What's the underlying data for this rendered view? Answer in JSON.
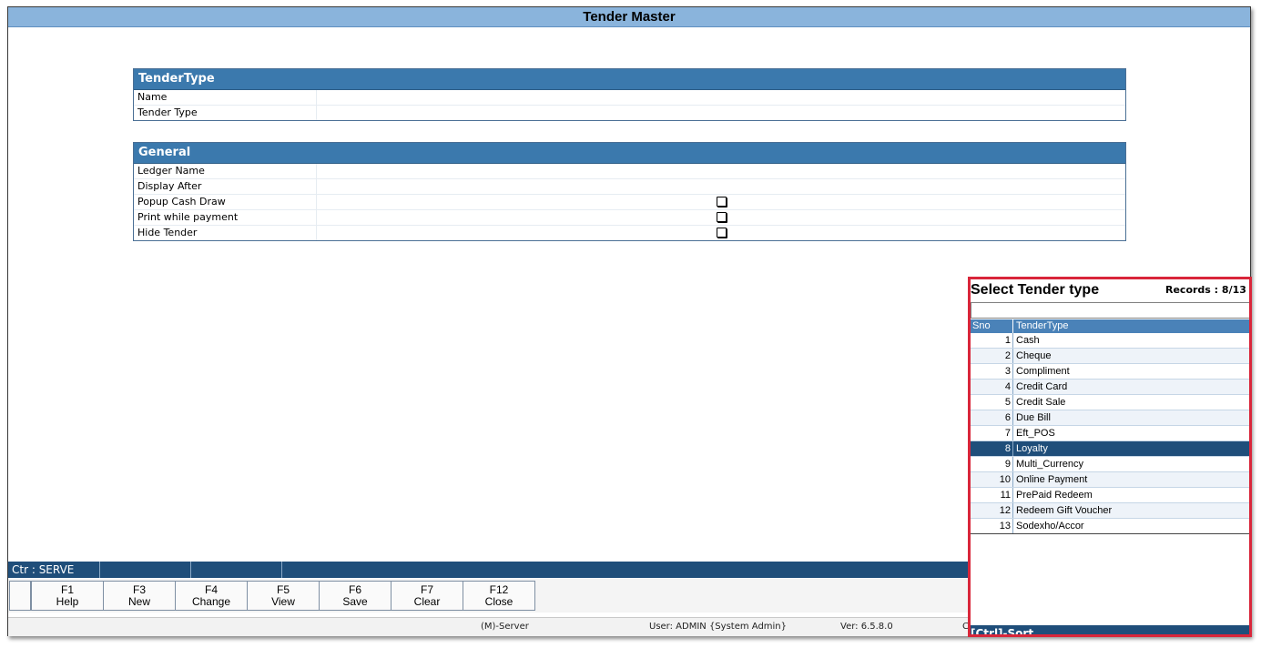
{
  "window": {
    "title": "Tender Master"
  },
  "tender_type_section": {
    "heading": "TenderType",
    "fields": [
      {
        "label": "Name",
        "value": ""
      },
      {
        "label": "Tender Type",
        "value": ""
      }
    ]
  },
  "general_section": {
    "heading": "General",
    "fields": [
      {
        "label": "Ledger Name",
        "value": ""
      },
      {
        "label": "Display After",
        "value": ""
      },
      {
        "label": "Popup Cash Draw",
        "checked": false
      },
      {
        "label": "Print while payment",
        "checked": false
      },
      {
        "label": "Hide Tender",
        "checked": false
      }
    ]
  },
  "status_bar": {
    "counter": "Ctr : SERVE"
  },
  "function_keys": [
    {
      "key": "F1",
      "label": "Help"
    },
    {
      "key": "F3",
      "label": "New"
    },
    {
      "key": "F4",
      "label": "Change"
    },
    {
      "key": "F5",
      "label": "View"
    },
    {
      "key": "F6",
      "label": "Save"
    },
    {
      "key": "F7",
      "label": "Clear"
    },
    {
      "key": "F12",
      "label": "Close"
    }
  ],
  "footer": {
    "server": "(M)-Server",
    "user": "User: ADMIN {System Admin}",
    "version": "Ver: 6.5.8.0",
    "extra": "C"
  },
  "popup": {
    "title": "Select Tender type",
    "records": "Records : 8/13",
    "search_value": "",
    "columns": {
      "sno": "Sno",
      "tender_type": "TenderType"
    },
    "selected_sno": 8,
    "rows": [
      {
        "sno": "1",
        "tender_type": "Cash"
      },
      {
        "sno": "2",
        "tender_type": "Cheque"
      },
      {
        "sno": "3",
        "tender_type": "Compliment"
      },
      {
        "sno": "4",
        "tender_type": "Credit Card"
      },
      {
        "sno": "5",
        "tender_type": "Credit Sale"
      },
      {
        "sno": "6",
        "tender_type": "Due Bill"
      },
      {
        "sno": "7",
        "tender_type": "Eft_POS"
      },
      {
        "sno": "8",
        "tender_type": "Loyalty"
      },
      {
        "sno": "9",
        "tender_type": "Multi_Currency"
      },
      {
        "sno": "10",
        "tender_type": "Online Payment"
      },
      {
        "sno": "11",
        "tender_type": "PrePaid Redeem"
      },
      {
        "sno": "12",
        "tender_type": "Redeem Gift Voucher"
      },
      {
        "sno": "13",
        "tender_type": "Sodexho/Accor"
      }
    ],
    "footer_hint": "[Ctrl]-Sort"
  },
  "colors": {
    "title_bar": "#8ab4dc",
    "section_header": "#3b79ad",
    "status_bar": "#1f4e7a",
    "selected_row": "#1f4e7a",
    "popup_border": "#d9263a"
  }
}
